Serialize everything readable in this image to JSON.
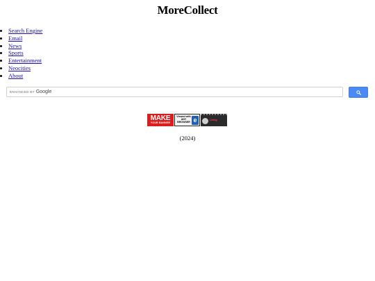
{
  "header": {
    "title": "MoreCollect"
  },
  "nav": {
    "items": [
      {
        "label": "Search Engine"
      },
      {
        "label": "Email"
      },
      {
        "label": "News"
      },
      {
        "label": "Sports"
      },
      {
        "label": "Entertainment"
      },
      {
        "label": "Neocities"
      },
      {
        "label": "About"
      }
    ]
  },
  "search": {
    "enhanced_label": "ENHANCED BY",
    "brand": "Google",
    "value": "",
    "button_icon": "search-icon",
    "button_color": "#4a8af4"
  },
  "badges": [
    {
      "name": "make-your-banner",
      "line1": "MAKE",
      "line2": "YOUR BANNER"
    },
    {
      "name": "viewed-any-browser",
      "text": "Viewed with ANY BROWSER",
      "icon": "e"
    },
    {
      "name": "living-badge",
      "text": "Living"
    }
  ],
  "footer": {
    "year": "(2024)"
  }
}
